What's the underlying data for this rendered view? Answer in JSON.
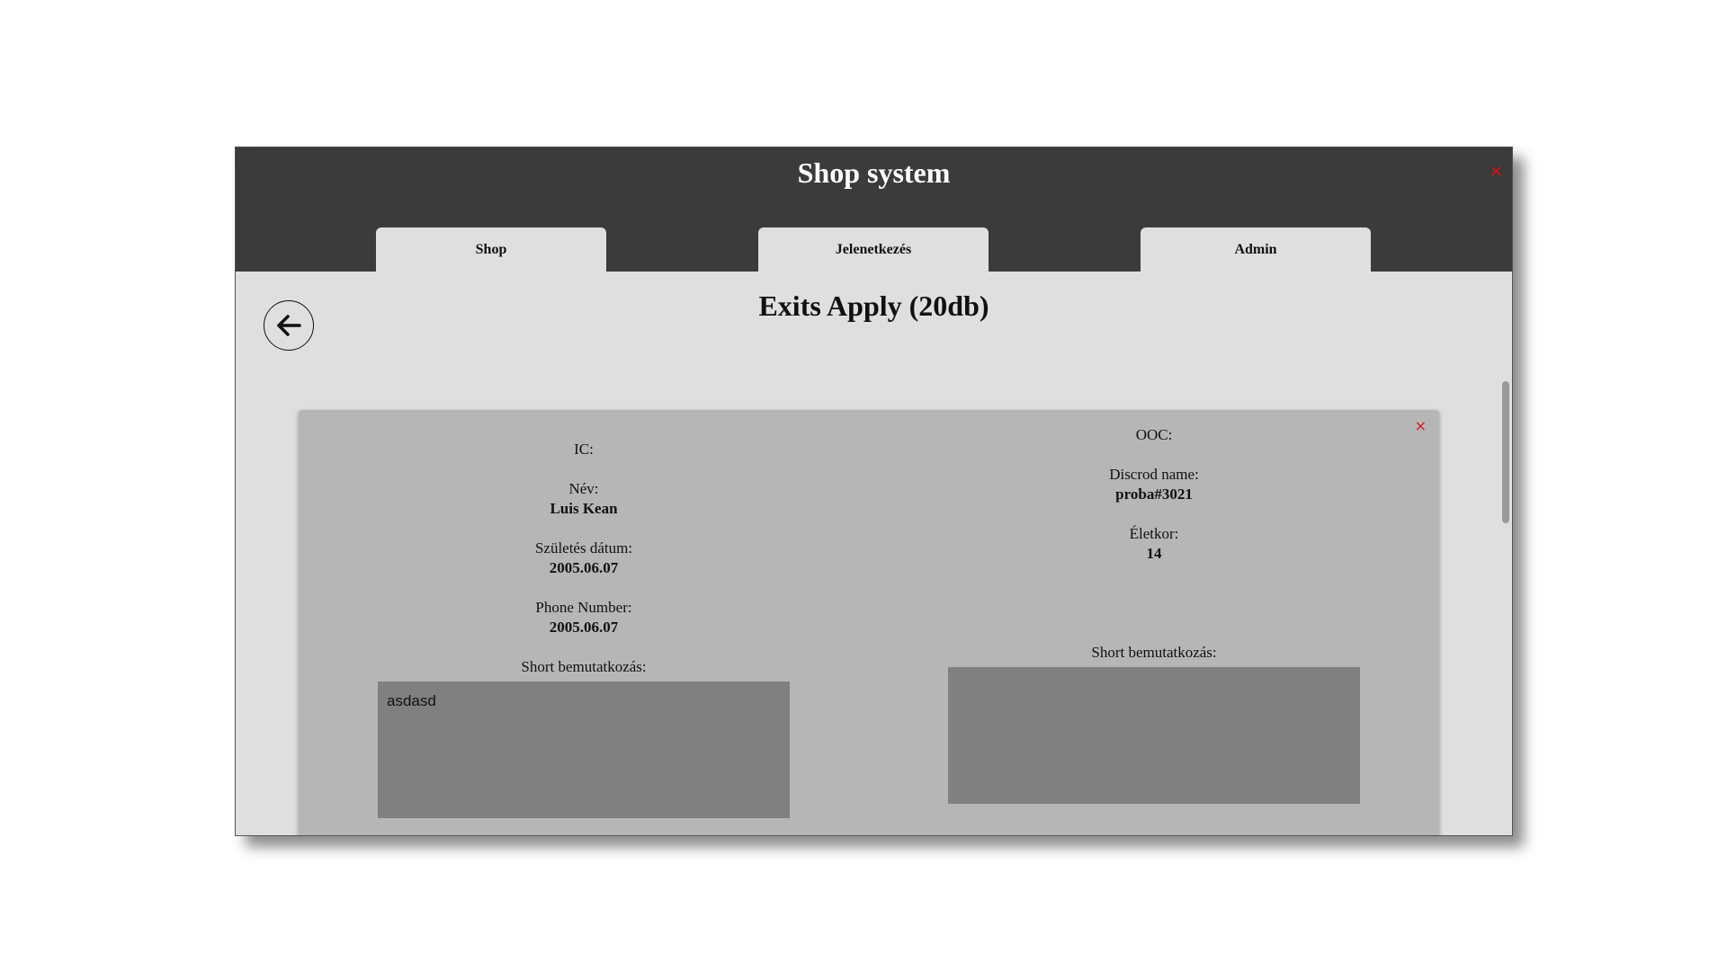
{
  "app": {
    "title": "Shop system",
    "close_symbol": "×"
  },
  "tabs": [
    {
      "label": "Shop"
    },
    {
      "label": "Jelenetkezés"
    },
    {
      "label": "Admin"
    }
  ],
  "page": {
    "title": "Exits Apply (20db)",
    "back_icon": "arrow-left-icon"
  },
  "application": {
    "close_symbol": "×",
    "ic": {
      "header": "IC:",
      "name_label": "Név:",
      "name_value": "Luis Kean",
      "birth_label": "Születés dátum:",
      "birth_value": "2005.06.07",
      "phone_label": "Phone Number:",
      "phone_value": "2005.06.07",
      "intro_label": "Short bemutatkozás:",
      "intro_value": "asdasd"
    },
    "ooc": {
      "header": "OOC:",
      "discord_label": "Discrod name:",
      "discord_value": "proba#3021",
      "age_label": "Életkor:",
      "age_value": "14",
      "intro_label": "Short bemutatkozás:",
      "intro_value": ""
    }
  },
  "colors": {
    "titlebar": "#3b3b3b",
    "background": "#dfdfdf",
    "card": "#b6b6b6",
    "textbox": "#808080",
    "close": "#e01010"
  }
}
